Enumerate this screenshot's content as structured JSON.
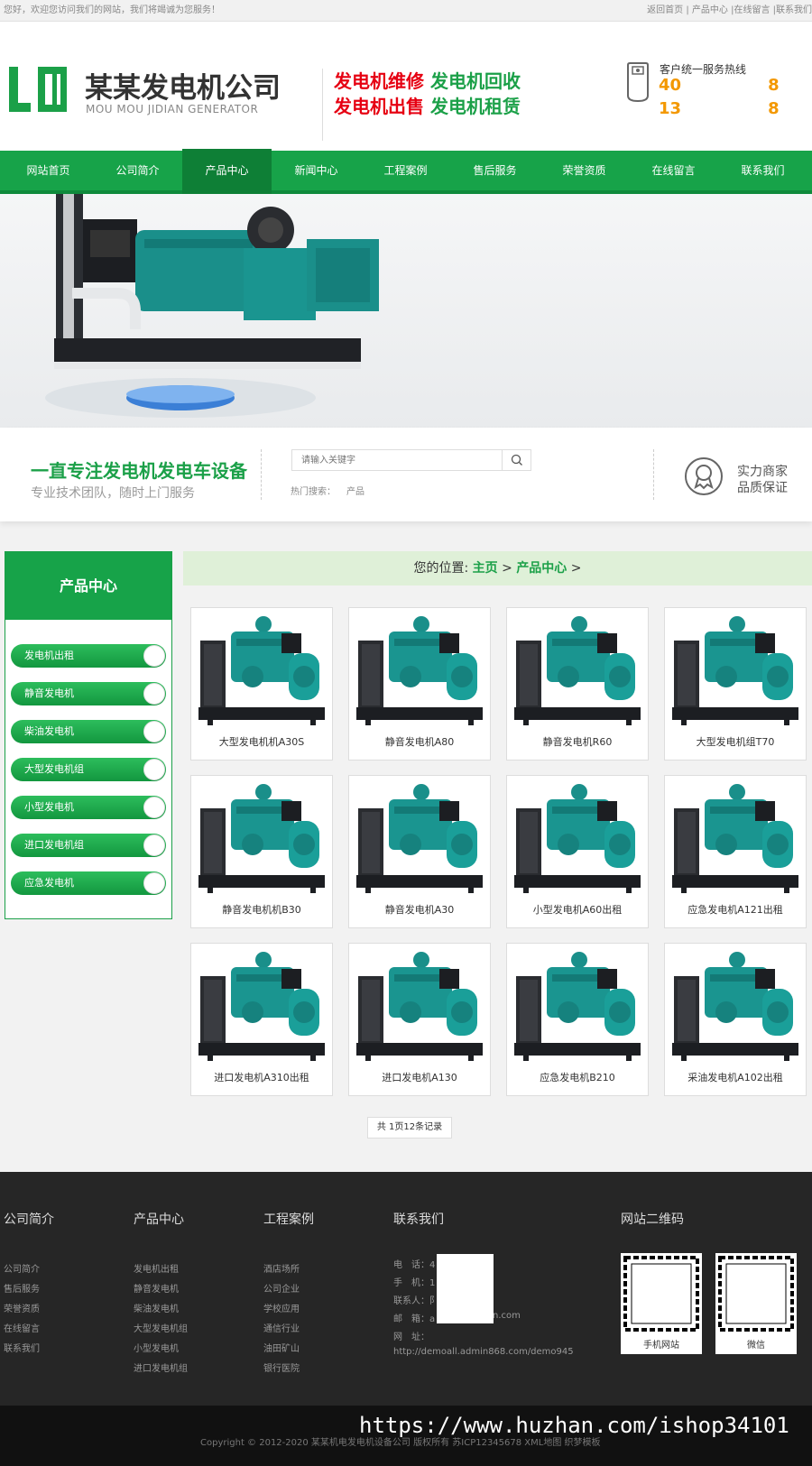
{
  "topbar": {
    "welcome": "您好，欢迎您访问我们的网站，我们将竭诚为您服务！",
    "links": "返回首页 | 产品中心 |在线留言 |联系我们"
  },
  "header": {
    "logo_text": "LD",
    "company_name": "某某发电机公司",
    "company_en": "MOU MOU JIDIAN GENERATOR",
    "slogan_line1": {
      "red": "发电机维修",
      "green": "发电机回收"
    },
    "slogan_line2": {
      "red": "发电机出售",
      "green": "发电机租赁"
    },
    "hotline_label": "客户统一服务热线",
    "hotline_line1_start": "40",
    "hotline_line1_end": "8",
    "hotline_line2_start": "13",
    "hotline_line2_end": "8"
  },
  "nav": {
    "items": [
      "网站首页",
      "公司简介",
      "产品中心",
      "新闻中心",
      "工程案例",
      "售后服务",
      "荣誉资质",
      "在线留言",
      "联系我们"
    ],
    "active": "产品中心"
  },
  "strip": {
    "title": "一直专注发电机发电车设备",
    "subtitle": "专业技术团队，随时上门服务",
    "search_placeholder": "请输入关键字",
    "hot_label": "热门搜索：",
    "hot_keyword": "产品",
    "badge_line1": "实力商家",
    "badge_line2": "品质保证"
  },
  "sidebar": {
    "title": "产品中心",
    "items": [
      "发电机出租",
      "静音发电机",
      "柴油发电机",
      "大型发电机组",
      "小型发电机",
      "进口发电机组",
      "应急发电机"
    ]
  },
  "breadcrumb": {
    "prefix": "您的位置: ",
    "home": "主页",
    "sep1": " > ",
    "current": "产品中心",
    "sep2": " >"
  },
  "products": [
    "大型发电机机A30S",
    "静音发电机A80",
    "静音发电机R60",
    "大型发电机组T70",
    "静音发电机机B30",
    "静音发电机A30",
    "小型发电机A60出租",
    "应急发电机A121出租",
    "进口发电机A310出租",
    "进口发电机A130",
    "应急发电机B210",
    "采油发电机A102出租"
  ],
  "pagination": "共 1页12条记录",
  "footer": {
    "col1": {
      "title": "公司简介",
      "links": [
        "公司简介",
        "售后服务",
        "荣誉资质",
        "在线留言",
        "联系我们"
      ]
    },
    "col2": {
      "title": "产品中心",
      "links": [
        "发电机出租",
        "静音发电机",
        "柴油发电机",
        "大型发电机组",
        "小型发电机",
        "进口发电机组"
      ]
    },
    "col3": {
      "title": "工程案例",
      "links": [
        "酒店场所",
        "公司企业",
        "学校应用",
        "通信行业",
        "油田矿山",
        "银行医院"
      ]
    },
    "contact": {
      "title": "联系我们",
      "lines": [
        "电　话：4",
        "手　机：1",
        "联系人：阝",
        "邮　箱：a",
        "网　址："
      ],
      "email_tail": "n.com",
      "url": "http://demoall.admin868.com/demo945"
    },
    "qr": {
      "title": "网站二维码",
      "mobile_label": "手机网站",
      "wechat_label": "微信"
    }
  },
  "copyright": "Copyright © 2012-2020 某某机电发电机设备公司 版权所有  苏ICP12345678  XML地图  织梦模板",
  "watermark": "https://www.huzhan.com/ishop34101",
  "colors": {
    "brand_green": "#17a349",
    "accent_red": "#e60012",
    "hotline_orange": "#f39800",
    "genset_teal": "#1a8f8a"
  }
}
